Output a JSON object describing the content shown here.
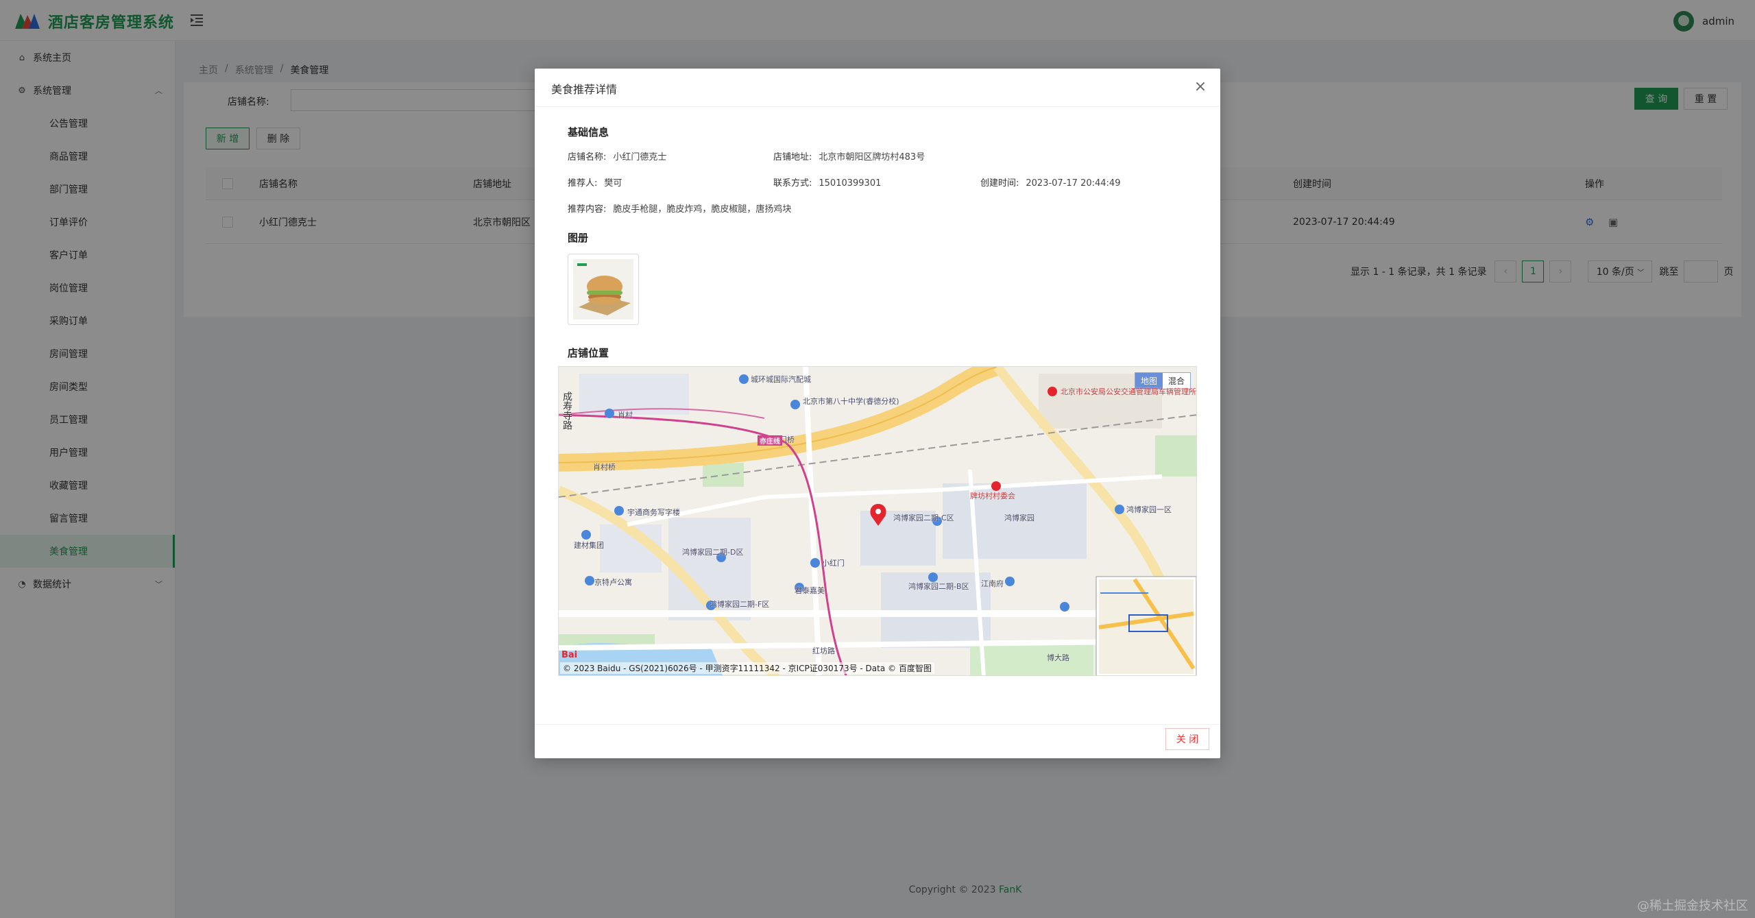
{
  "header": {
    "title": "酒店客房管理系统",
    "username": "admin"
  },
  "sidebar": {
    "home": "系统主页",
    "system": "系统管理",
    "items": [
      "公告管理",
      "商品管理",
      "部门管理",
      "订单评价",
      "客户订单",
      "岗位管理",
      "采购订单",
      "房间管理",
      "房间类型",
      "员工管理",
      "用户管理",
      "收藏管理",
      "留言管理",
      "美食管理"
    ],
    "stats": "数据统计"
  },
  "breadcrumb": [
    "主页",
    "系统管理",
    "美食管理"
  ],
  "search": {
    "label": "店铺名称:",
    "query": "查 询",
    "reset": "重 置"
  },
  "toolbar": {
    "add": "新 增",
    "delete": "删 除"
  },
  "table": {
    "columns": [
      "店铺名称",
      "店铺地址",
      "创建时间",
      "操作"
    ],
    "rows": [
      {
        "name": "小红门德克士",
        "address": "北京市朝阳区",
        "created": "2023-07-17 20:44:49"
      }
    ]
  },
  "pager": {
    "summary": "显示 1 - 1 条记录，共 1 条记录",
    "current": "1",
    "page_size": "10 条/页",
    "jump": "跳至",
    "page_unit": "页"
  },
  "footer": {
    "copyright": "Copyright © 2023 ",
    "author": "FanK"
  },
  "watermark": "@稀土掘金技术社区",
  "modal": {
    "title": "美食推荐详情",
    "basic_title": "基础信息",
    "shop_name_label": "店铺名称:",
    "shop_name": "小红门德克士",
    "address_label": "店铺地址:",
    "address": "北京市朝阳区牌坊村483号",
    "recommender_label": "推荐人:",
    "recommender": "樊可",
    "phone_label": "联系方式:",
    "phone": "15010399301",
    "created_label": "创建时间:",
    "created": "2023-07-17 20:44:49",
    "content_label": "推荐内容:",
    "content": "脆皮手枪腿，脆皮炸鸡，脆皮椒腿，唐扬鸡块",
    "album_title": "图册",
    "location_title": "店铺位置",
    "map_type_map": "地图",
    "map_type_hybrid": "混合",
    "map_labels": [
      "城环城国际汽配城",
      "北京市第八十中学(睿德分校)",
      "北京市公安局公安交通管理局车辆管理所",
      "成寿寺路",
      "肖村",
      "肖村桥",
      "小红门桥",
      "亦庄线",
      "牌坊村村委会",
      "宇通商务写字楼",
      "鸿博家园二期-C区",
      "鸿博家园",
      "鸿博家园一区",
      "建材集团",
      "鸿博家园二期-D区",
      "小红门",
      "京特卢公寓",
      "鸿博家园二期-F区",
      "君泰嘉美",
      "鸿博家园二期-B区",
      "江南府",
      "红坊路",
      "博大路"
    ],
    "map_attrib": "© 2023 Baidu - GS(2021)6026号 - 甲测资字11111342 - 京ICP证030173号 - Data © 百度智图",
    "baidu_logo": "Bai",
    "close": "关 闭"
  }
}
